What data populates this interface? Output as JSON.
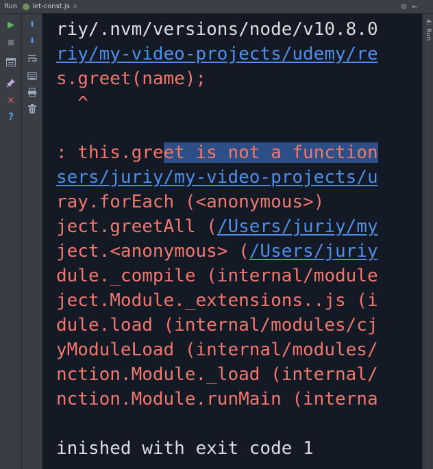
{
  "titlebar": {
    "run_label": "Run",
    "tab_label": "let-const.js",
    "tab_close": "×",
    "settings_glyph": "⚙",
    "hide_glyph": "⇤"
  },
  "side_strip": {
    "label": "4: Run"
  },
  "toolbar": {
    "run_glyph": "▶",
    "stop_glyph": "■",
    "up_glyph": "⬆",
    "down_glyph": "⬇",
    "close_glyph": "✕",
    "help_glyph": "?"
  },
  "colors": {
    "console_bg": "#141a25",
    "error_red": "#f0776c",
    "link_blue": "#4d8fe8",
    "selection": "#2b4f86",
    "run_green": "#5fb65f"
  },
  "console": {
    "lines": [
      {
        "segments": [
          {
            "text": "riy/.nvm/versions/node/v10.8.0",
            "style": "white"
          }
        ]
      },
      {
        "segments": [
          {
            "text": "riy/my-video-projects/udemy/re",
            "style": "link"
          }
        ]
      },
      {
        "segments": [
          {
            "text": "s.greet(name);",
            "style": "red"
          }
        ]
      },
      {
        "segments": [
          {
            "text": "  ^",
            "style": "red"
          }
        ]
      },
      {
        "segments": []
      },
      {
        "segments": [
          {
            "text": ": this.gre",
            "style": "red"
          },
          {
            "text": "et is not a function",
            "style": "sel"
          }
        ]
      },
      {
        "segments": [
          {
            "text": "sers/juriy/my-video-projects/u",
            "style": "link"
          }
        ]
      },
      {
        "segments": [
          {
            "text": "ray.forEach (<anonymous>)",
            "style": "red"
          }
        ]
      },
      {
        "segments": [
          {
            "text": "ject.greetAll (",
            "style": "red"
          },
          {
            "text": "/Users/juriy/my",
            "style": "link"
          }
        ]
      },
      {
        "segments": [
          {
            "text": "ject.<anonymous> (",
            "style": "red"
          },
          {
            "text": "/Users/juriy",
            "style": "link"
          }
        ]
      },
      {
        "segments": [
          {
            "text": "dule._compile (internal/module",
            "style": "red"
          }
        ]
      },
      {
        "segments": [
          {
            "text": "ject.Module._extensions..js (i",
            "style": "red"
          }
        ]
      },
      {
        "segments": [
          {
            "text": "dule.load (internal/modules/cj",
            "style": "red"
          }
        ]
      },
      {
        "segments": [
          {
            "text": "yModuleLoad (internal/modules/",
            "style": "red"
          }
        ]
      },
      {
        "segments": [
          {
            "text": "nction.Module._load (internal/",
            "style": "red"
          }
        ]
      },
      {
        "segments": [
          {
            "text": "nction.Module.runMain (interna",
            "style": "red"
          }
        ]
      },
      {
        "segments": []
      },
      {
        "segments": [
          {
            "text": "inished with exit code 1",
            "style": "white"
          }
        ]
      }
    ]
  }
}
